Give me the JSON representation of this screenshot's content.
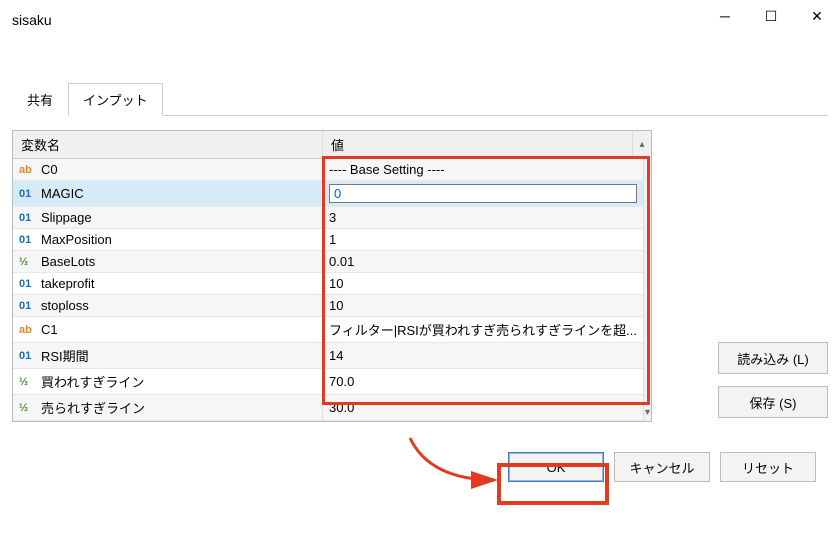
{
  "title": "sisaku",
  "tabs": {
    "share": "共有",
    "input": "インプット"
  },
  "headers": {
    "name": "変数名",
    "value": "値"
  },
  "rows": [
    {
      "type": "ab",
      "name": "C0",
      "value": "---- Base Setting ----"
    },
    {
      "type": "01",
      "name": "MAGIC",
      "value": "0",
      "editing": true
    },
    {
      "type": "01",
      "name": "Slippage",
      "value": "3"
    },
    {
      "type": "01",
      "name": "MaxPosition",
      "value": "1"
    },
    {
      "type": "12",
      "name": "BaseLots",
      "value": "0.01"
    },
    {
      "type": "01",
      "name": "takeprofit",
      "value": "10"
    },
    {
      "type": "01",
      "name": "stoploss",
      "value": "10"
    },
    {
      "type": "ab",
      "name": "C1",
      "value": "フィルター|RSIが買われすぎ売られすぎラインを超..."
    },
    {
      "type": "01",
      "name": "RSI期間",
      "value": "14"
    },
    {
      "type": "12",
      "name": "買われすぎライン",
      "value": "70.0"
    },
    {
      "type": "12",
      "name": "売られすぎライン",
      "value": "30.0"
    }
  ],
  "typeLabels": {
    "ab": "ab",
    "01": "01",
    "12": "½"
  },
  "sideButtons": {
    "load": "読み込み (L)",
    "save": "保存 (S)"
  },
  "bottomButtons": {
    "ok": "OK",
    "cancel": "キャンセル",
    "reset": "リセット"
  }
}
